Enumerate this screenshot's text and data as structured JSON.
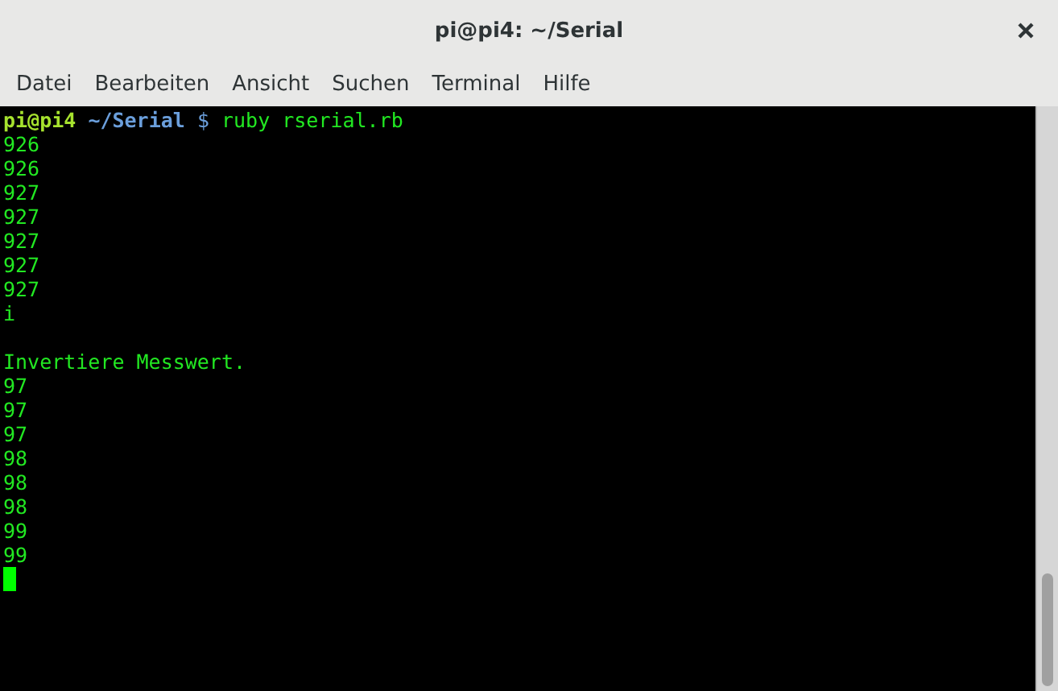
{
  "window": {
    "title": "pi@pi4: ~/Serial"
  },
  "menu": [
    "Datei",
    "Bearbeiten",
    "Ansicht",
    "Suchen",
    "Terminal",
    "Hilfe"
  ],
  "terminal": {
    "prompt": {
      "user_host": "pi@pi4",
      "path": "~/Serial",
      "symbol": "$",
      "command": "ruby rserial.rb"
    },
    "lines": [
      {
        "kind": "output",
        "text": "926"
      },
      {
        "kind": "output",
        "text": "926"
      },
      {
        "kind": "output",
        "text": "927"
      },
      {
        "kind": "output",
        "text": "927"
      },
      {
        "kind": "output",
        "text": "927"
      },
      {
        "kind": "output",
        "text": "927"
      },
      {
        "kind": "output",
        "text": "927"
      },
      {
        "kind": "output",
        "text": "i"
      },
      {
        "kind": "blank"
      },
      {
        "kind": "output",
        "text": "Invertiere Messwert."
      },
      {
        "kind": "output",
        "text": "97"
      },
      {
        "kind": "output",
        "text": "97"
      },
      {
        "kind": "output",
        "text": "97"
      },
      {
        "kind": "output",
        "text": "98"
      },
      {
        "kind": "output",
        "text": "98"
      },
      {
        "kind": "output",
        "text": "98"
      },
      {
        "kind": "output",
        "text": "99"
      },
      {
        "kind": "output",
        "text": "99"
      },
      {
        "kind": "cursor"
      }
    ]
  }
}
